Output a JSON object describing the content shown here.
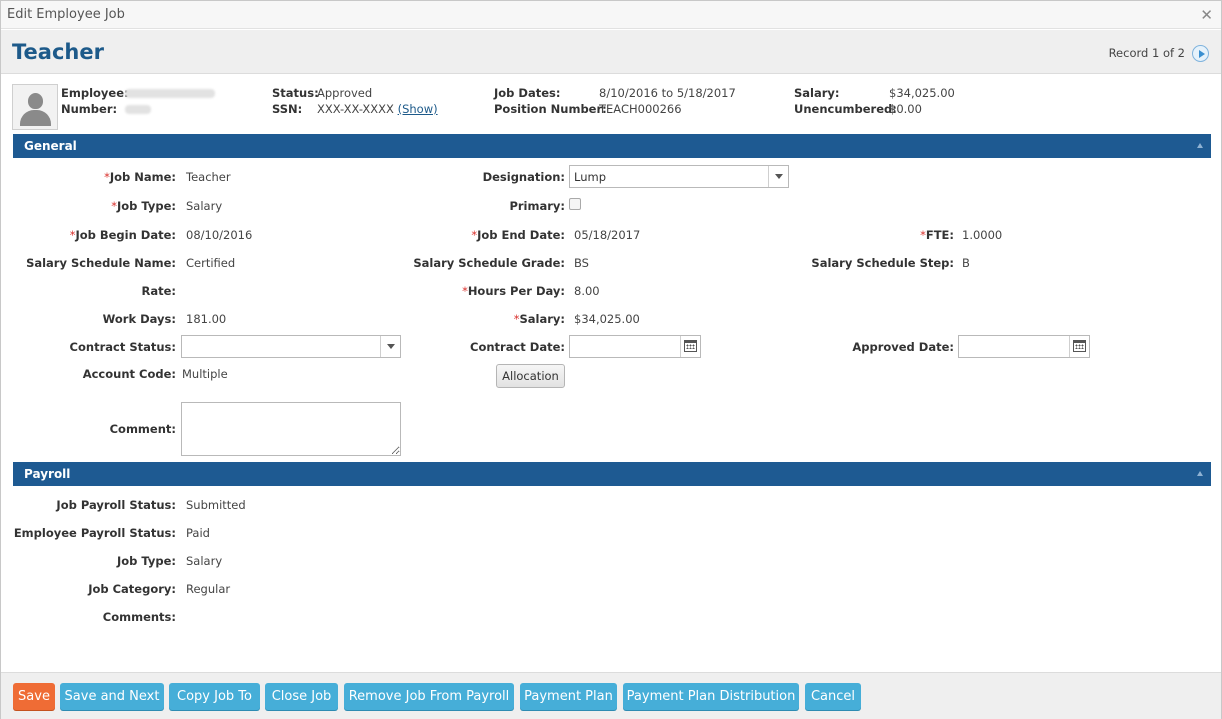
{
  "window": {
    "title": "Edit Employee Job"
  },
  "header": {
    "page_title": "Teacher",
    "record_text": "Record 1 of 2"
  },
  "summary": {
    "employee_label": "Employee:",
    "number_label": "Number:",
    "status_label": "Status:",
    "status_value": "Approved",
    "ssn_label": "SSN:",
    "ssn_value": "XXX-XX-XXXX",
    "ssn_show": "(Show)",
    "job_dates_label": "Job Dates:",
    "job_dates_value": "8/10/2016 to 5/18/2017",
    "position_number_label": "Position Number:",
    "position_number_value": "TEACH000266",
    "salary_label": "Salary:",
    "salary_value": "$34,025.00",
    "unencumbered_label": "Unencumbered:",
    "unencumbered_value": "$0.00"
  },
  "general": {
    "title": "General",
    "job_name_label": "Job Name:",
    "job_name_value": "Teacher",
    "job_type_label": "Job Type:",
    "job_type_value": "Salary",
    "job_begin_label": "Job Begin Date:",
    "job_begin_value": "08/10/2016",
    "salary_schedule_name_label": "Salary Schedule Name:",
    "salary_schedule_name_value": "Certified",
    "rate_label": "Rate:",
    "work_days_label": "Work Days:",
    "work_days_value": "181.00",
    "contract_status_label": "Contract Status:",
    "contract_status_value": "",
    "account_code_label": "Account Code:",
    "account_code_value": "Multiple",
    "comment_label": "Comment:",
    "designation_label": "Designation:",
    "designation_value": "Lump",
    "primary_label": "Primary:",
    "job_end_label": "Job End Date:",
    "job_end_value": "05/18/2017",
    "salary_schedule_grade_label": "Salary Schedule Grade:",
    "salary_schedule_grade_value": "BS",
    "hours_per_day_label": "Hours Per Day:",
    "hours_per_day_value": "8.00",
    "salary_label": "Salary:",
    "salary_value": "$34,025.00",
    "contract_date_label": "Contract Date:",
    "allocation_button": "Allocation",
    "fte_label": "FTE:",
    "fte_value": "1.0000",
    "salary_schedule_step_label": "Salary Schedule Step:",
    "salary_schedule_step_value": "B",
    "approved_date_label": "Approved Date:"
  },
  "payroll": {
    "title": "Payroll",
    "job_payroll_status_label": "Job Payroll Status:",
    "job_payroll_status_value": "Submitted",
    "employee_payroll_status_label": "Employee Payroll Status:",
    "employee_payroll_status_value": "Paid",
    "job_type_label": "Job Type:",
    "job_type_value": "Salary",
    "job_category_label": "Job Category:",
    "job_category_value": "Regular",
    "comments_label": "Comments:"
  },
  "footer": {
    "save": "Save",
    "save_and_next": "Save and Next",
    "copy_job_to": "Copy Job To",
    "close_job": "Close Job",
    "remove_job": "Remove Job From Payroll",
    "payment_plan": "Payment Plan",
    "payment_plan_distribution": "Payment Plan Distribution",
    "cancel": "Cancel"
  },
  "colors": {
    "section_bar": "#1e5a92",
    "title_blue": "#1d5a8a",
    "button_blue": "#46aed8",
    "button_orange": "#ef6c35",
    "required": "#d9302c"
  },
  "icons": [
    "close-icon",
    "next-record-icon",
    "avatar-placeholder-icon",
    "collapse-icon",
    "dropdown-arrow-icon",
    "calendar-icon"
  ]
}
